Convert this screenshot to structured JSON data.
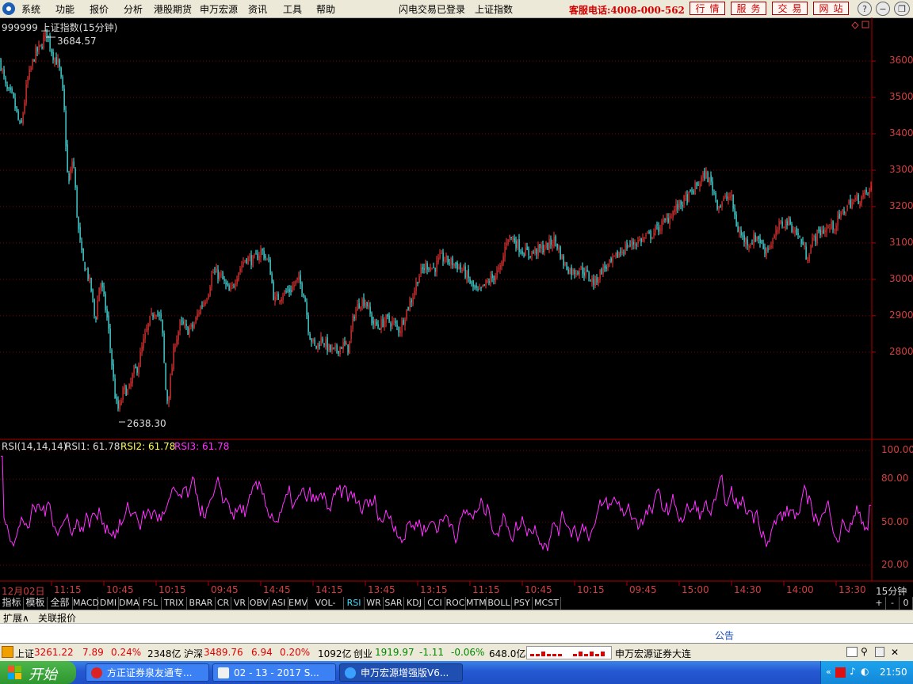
{
  "menubar": {
    "items": [
      "系统",
      "功能",
      "报价",
      "分析",
      "港股期货",
      "申万宏源",
      "资讯",
      "工具",
      "帮助"
    ],
    "login_status": "闪电交易已登录",
    "current_view": "上证指数",
    "hotline": "客服电话:4008-000-562",
    "nav_buttons": [
      "行情",
      "服务",
      "交易",
      "网站"
    ],
    "window_buttons": [
      "?",
      "−",
      "❐",
      "✕"
    ]
  },
  "chart": {
    "title": "999999 上证指数(15分钟)",
    "high_marker": "3684.57",
    "low_marker": "2638.30",
    "rsi_title": "RSI(14,14,14)",
    "rsi1_label": "RSI1: 61.78",
    "rsi2_label": "RSI2: 61.78",
    "rsi3_label": "RSI3: 61.78",
    "period_label": "15分钟",
    "colors": {
      "up": "#ff3b3b",
      "down": "#55ffff",
      "rsi": "#ff33ff",
      "axis": "#b00000",
      "grid": "#7a0000",
      "rsi2": "#ffff55"
    }
  },
  "chart_data": {
    "type": "line",
    "title": "999999 上证指数(15分钟)",
    "price": {
      "ylim": [
        2560,
        3720
      ],
      "ticks": [
        2800,
        2900,
        3000,
        3100,
        3200,
        3300,
        3400,
        3500,
        3600
      ],
      "high": 3684.57,
      "low": 2638.3,
      "points": [
        [
          0,
          3600
        ],
        [
          8,
          3520
        ],
        [
          16,
          3500
        ],
        [
          26,
          3410
        ],
        [
          34,
          3540
        ],
        [
          44,
          3620
        ],
        [
          52,
          3640
        ],
        [
          58,
          3684.57
        ],
        [
          66,
          3620
        ],
        [
          74,
          3590
        ],
        [
          80,
          3500
        ],
        [
          86,
          3250
        ],
        [
          92,
          3340
        ],
        [
          98,
          3150
        ],
        [
          104,
          3050
        ],
        [
          110,
          3020
        ],
        [
          116,
          2960
        ],
        [
          120,
          2880
        ],
        [
          126,
          3000
        ],
        [
          130,
          2960
        ],
        [
          136,
          2880
        ],
        [
          140,
          2790
        ],
        [
          146,
          2660
        ],
        [
          150,
          2638.3
        ],
        [
          156,
          2700
        ],
        [
          162,
          2690
        ],
        [
          168,
          2740
        ],
        [
          174,
          2760
        ],
        [
          180,
          2820
        ],
        [
          188,
          2880
        ],
        [
          196,
          2920
        ],
        [
          204,
          2880
        ],
        [
          210,
          2660
        ],
        [
          214,
          2700
        ],
        [
          220,
          2820
        ],
        [
          228,
          2880
        ],
        [
          236,
          2860
        ],
        [
          244,
          2870
        ],
        [
          252,
          2920
        ],
        [
          262,
          2960
        ],
        [
          268,
          3020
        ],
        [
          278,
          3010
        ],
        [
          290,
          2960
        ],
        [
          300,
          3020
        ],
        [
          310,
          3060
        ],
        [
          320,
          3050
        ],
        [
          330,
          3080
        ],
        [
          340,
          3040
        ],
        [
          346,
          2940
        ],
        [
          356,
          2960
        ],
        [
          366,
          2970
        ],
        [
          376,
          3000
        ],
        [
          384,
          2960
        ],
        [
          390,
          2850
        ],
        [
          398,
          2810
        ],
        [
          406,
          2840
        ],
        [
          414,
          2810
        ],
        [
          422,
          2800
        ],
        [
          432,
          2820
        ],
        [
          440,
          2810
        ],
        [
          446,
          2900
        ],
        [
          454,
          2940
        ],
        [
          462,
          2940
        ],
        [
          470,
          2880
        ],
        [
          478,
          2870
        ],
        [
          486,
          2890
        ],
        [
          496,
          2880
        ],
        [
          504,
          2860
        ],
        [
          512,
          2910
        ],
        [
          520,
          2950
        ],
        [
          528,
          3010
        ],
        [
          538,
          3040
        ],
        [
          548,
          3030
        ],
        [
          556,
          3060
        ],
        [
          566,
          3050
        ],
        [
          576,
          3040
        ],
        [
          586,
          3020
        ],
        [
          596,
          2980
        ],
        [
          604,
          2960
        ],
        [
          614,
          2990
        ],
        [
          624,
          3010
        ],
        [
          632,
          3030
        ],
        [
          640,
          3120
        ],
        [
          648,
          3110
        ],
        [
          658,
          3080
        ],
        [
          668,
          3070
        ],
        [
          678,
          3080
        ],
        [
          690,
          3090
        ],
        [
          700,
          3110
        ],
        [
          712,
          3040
        ],
        [
          722,
          3020
        ],
        [
          732,
          3030
        ],
        [
          742,
          3010
        ],
        [
          750,
          2990
        ],
        [
          760,
          3030
        ],
        [
          770,
          3040
        ],
        [
          780,
          3070
        ],
        [
          790,
          3090
        ],
        [
          800,
          3100
        ],
        [
          810,
          3110
        ],
        [
          820,
          3120
        ],
        [
          830,
          3140
        ],
        [
          840,
          3160
        ],
        [
          850,
          3190
        ],
        [
          860,
          3210
        ],
        [
          870,
          3230
        ],
        [
          880,
          3260
        ],
        [
          890,
          3290
        ],
        [
          898,
          3260
        ],
        [
          906,
          3200
        ],
        [
          914,
          3220
        ],
        [
          922,
          3230
        ],
        [
          930,
          3140
        ],
        [
          938,
          3110
        ],
        [
          946,
          3100
        ],
        [
          956,
          3120
        ],
        [
          964,
          3080
        ],
        [
          974,
          3100
        ],
        [
          984,
          3150
        ],
        [
          994,
          3160
        ],
        [
          1004,
          3130
        ],
        [
          1012,
          3100
        ],
        [
          1018,
          3060
        ],
        [
          1026,
          3110
        ],
        [
          1034,
          3130
        ],
        [
          1044,
          3140
        ],
        [
          1054,
          3150
        ],
        [
          1062,
          3180
        ],
        [
          1072,
          3210
        ],
        [
          1082,
          3220
        ],
        [
          1090,
          3230
        ],
        [
          1100,
          3250
        ]
      ]
    },
    "rsi": {
      "ylim": [
        10,
        105
      ],
      "ticks": [
        20,
        50,
        80,
        100
      ],
      "tick_labels": [
        "20.00",
        "50.00",
        "80.00",
        "100.00"
      ],
      "last": 61.78
    },
    "x_axis_labels": [
      "12月02日",
      "11:15",
      "10:45",
      "10:15",
      "09:45",
      "14:45",
      "14:15",
      "13:45",
      "13:15",
      "11:15",
      "10:45",
      "10:15",
      "09:45",
      "15:00",
      "14:30",
      "14:00",
      "13:30"
    ]
  },
  "indicator_tabs": [
    "指标",
    "模板",
    "全部",
    "MACD",
    "DMI",
    "DMA",
    "FSL",
    "TRIX",
    "BRAR",
    "CR",
    "VR",
    "OBV",
    "ASI",
    "EMV",
    "VOL-TDX",
    "RSI",
    "WR",
    "SAR",
    "KDJ",
    "CCI",
    "ROC",
    "MTM",
    "BOLL",
    "PSY",
    "MCST"
  ],
  "active_tab": "RSI",
  "tab_right": [
    "+",
    "-",
    "0"
  ],
  "ext_tabs": [
    "扩展∧",
    "关联报价"
  ],
  "notice_title": "公告",
  "status": {
    "sh_label": "上证",
    "sh_value": "3261.22",
    "sh_change": "7.89",
    "sh_pct": "0.24%",
    "sh_amount": "2348亿",
    "hs_label": "沪深",
    "hs_value": "3489.76",
    "hs_change": "6.94",
    "hs_pct": "0.20%",
    "hs_amount": "1092亿",
    "cy_label": "创业",
    "cy_value": "1919.97",
    "cy_change": "-1.11",
    "cy_pct": "-0.06%",
    "cy_amount": "648.0亿",
    "broker": "申万宏源证券大连"
  },
  "taskbar": {
    "start": "开始",
    "tasks": [
      "方正证券泉友通专...",
      "02 - 13 - 2017 S...",
      "申万宏源增强版V6..."
    ],
    "clock": "21:50"
  }
}
